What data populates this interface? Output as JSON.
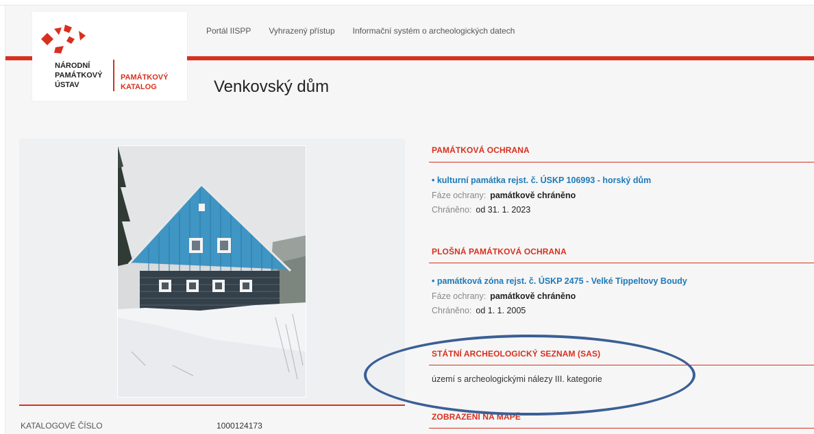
{
  "nav": {
    "items": [
      "Portál IISPP",
      "Vyhrazený přístup",
      "Informační systém o archeologických datech"
    ]
  },
  "logo": {
    "left_lines": [
      "NÁRODNÍ",
      "PAMÁTKOVÝ",
      "ÚSTAV"
    ],
    "right_lines": [
      "PAMÁTKOVÝ",
      "KATALOG"
    ],
    "mark_color": "#d8301f"
  },
  "page": {
    "title": "Venkovský dům"
  },
  "catalog": {
    "label": "KATALOGOVÉ ČÍSLO",
    "value": "1000124173"
  },
  "sections": {
    "protection": {
      "heading": "PAMÁTKOVÁ OCHRANA",
      "link": "• kulturní památka rejst. č. ÚSKP 106993 - horský dům",
      "phase_label": "Fáze ochrany:",
      "phase_value": "památkově chráněno",
      "protected_label": "Chráněno:",
      "protected_value": "od 31. 1. 2023"
    },
    "area_protection": {
      "heading": "PLOŠNÁ PAMÁTKOVÁ OCHRANA",
      "link": "• památková zóna rejst. č. ÚSKP 2475 - Velké Tippeltovy Boudy",
      "phase_label": "Fáze ochrany:",
      "phase_value": "památkově chráněno",
      "protected_label": "Chráněno:",
      "protected_value": "od 1. 1. 2005"
    },
    "sas": {
      "heading": "STÁTNÍ ARCHEOLOGICKÝ SEZNAM (SAS)",
      "text": "území s archeologickými nálezy III. kategorie"
    },
    "map": {
      "heading": "ZOBRAZENÍ NA MAPĚ"
    }
  },
  "colors": {
    "accent": "#d8301f",
    "link": "#1e7ab8",
    "annotation": "#3a5f95"
  }
}
